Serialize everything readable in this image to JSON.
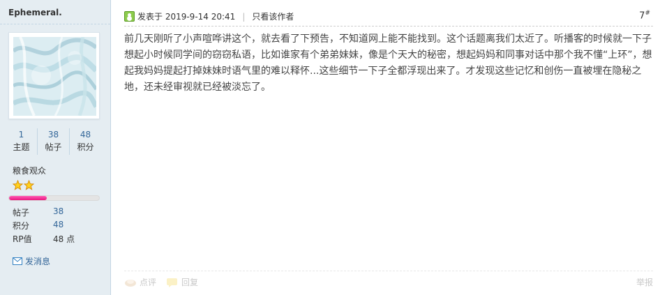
{
  "sidebar": {
    "username": "Ephemeral.",
    "stats": [
      {
        "value": "1",
        "label": "主题"
      },
      {
        "value": "38",
        "label": "帖子"
      },
      {
        "value": "48",
        "label": "积分"
      }
    ],
    "rank_title": "粮食观众",
    "star_count": 2,
    "level_progress": 0.42,
    "info": [
      {
        "label": "帖子",
        "value": "38"
      },
      {
        "label": "积分",
        "value": "48"
      },
      {
        "label": "RP值",
        "value": "48 点"
      }
    ],
    "pm_label": "发消息",
    "pm_icon": "envelope-icon"
  },
  "post": {
    "time": "发表于 2019-9-14 20:41",
    "separator": "|",
    "only_author": "只看该作者",
    "floor_number": "7",
    "floor_suffix": "#",
    "body": "前几天刚听了小声喧哗讲这个，就去看了下预告，不知道网上能不能找到。这个话题离我们太近了。听播客的时候就一下子想起小时候同学间的窃窃私语，比如谁家有个弟弟妹妹，像是个天大的秘密，想起妈妈和同事对话中那个我不懂“上环”，想起我妈妈提起打掉妹妹时语气里的难以释怀...这些细节一下子全都浮现出来了。才发现这些记忆和创伤一直被埋在隐秘之地，还未经审视就已经被淡忘了。",
    "footer": {
      "comment": "点评",
      "reply": "回复",
      "report": "举报"
    }
  },
  "colors": {
    "sidebar_bg": "#e5edf2",
    "link": "#336699",
    "progress": "#e8187f"
  }
}
